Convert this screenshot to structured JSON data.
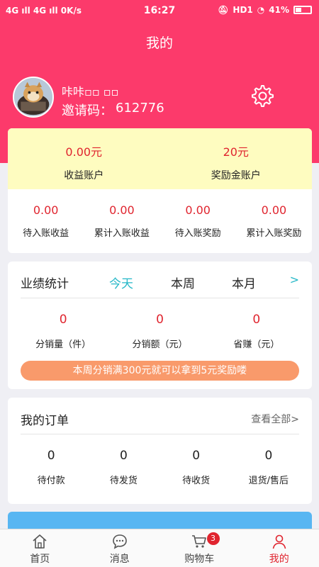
{
  "status": {
    "left": "4G ıll 4G ıll 0K/s",
    "time": "16:27",
    "right": "HD1",
    "battery": "41%"
  },
  "header": {
    "title": "我的",
    "username": "咔咔▫▫ ▫▫",
    "invite_label": "邀请码：",
    "invite_code": "612776"
  },
  "accounts": {
    "top": [
      {
        "value": "0.00元",
        "label": "收益账户"
      },
      {
        "value": "20元",
        "label": "奖励金账户"
      }
    ],
    "bottom": [
      {
        "value": "0.00",
        "label": "待入账收益"
      },
      {
        "value": "0.00",
        "label": "累计入账收益"
      },
      {
        "value": "0.00",
        "label": "待入账奖励"
      },
      {
        "value": "0.00",
        "label": "累计入账奖励"
      }
    ]
  },
  "performance": {
    "title": "业绩统计",
    "tabs": [
      "今天",
      "本周",
      "本月"
    ],
    "more": ">",
    "stats": [
      {
        "value": "0",
        "label": "分销量（件）"
      },
      {
        "value": "0",
        "label": "分销额（元）"
      },
      {
        "value": "0",
        "label": "省赚（元）"
      }
    ],
    "banner": "本周分销满300元就可以拿到5元奖励喽"
  },
  "orders": {
    "title": "我的订单",
    "view_all": "查看全部>",
    "items": [
      {
        "value": "0",
        "label": "待付款"
      },
      {
        "value": "0",
        "label": "待发货"
      },
      {
        "value": "0",
        "label": "待收货"
      },
      {
        "value": "0",
        "label": "退货/售后"
      }
    ]
  },
  "tabbar": {
    "items": [
      {
        "label": "首页",
        "icon": "home-icon"
      },
      {
        "label": "消息",
        "icon": "message-icon"
      },
      {
        "label": "购物车",
        "icon": "cart-icon",
        "badge": "3"
      },
      {
        "label": "我的",
        "icon": "user-icon"
      }
    ]
  },
  "colors": {
    "brand": "#fc3a6b",
    "accent": "#26b8c8",
    "value_red": "#e0252f",
    "banner": "#f99a6b"
  }
}
